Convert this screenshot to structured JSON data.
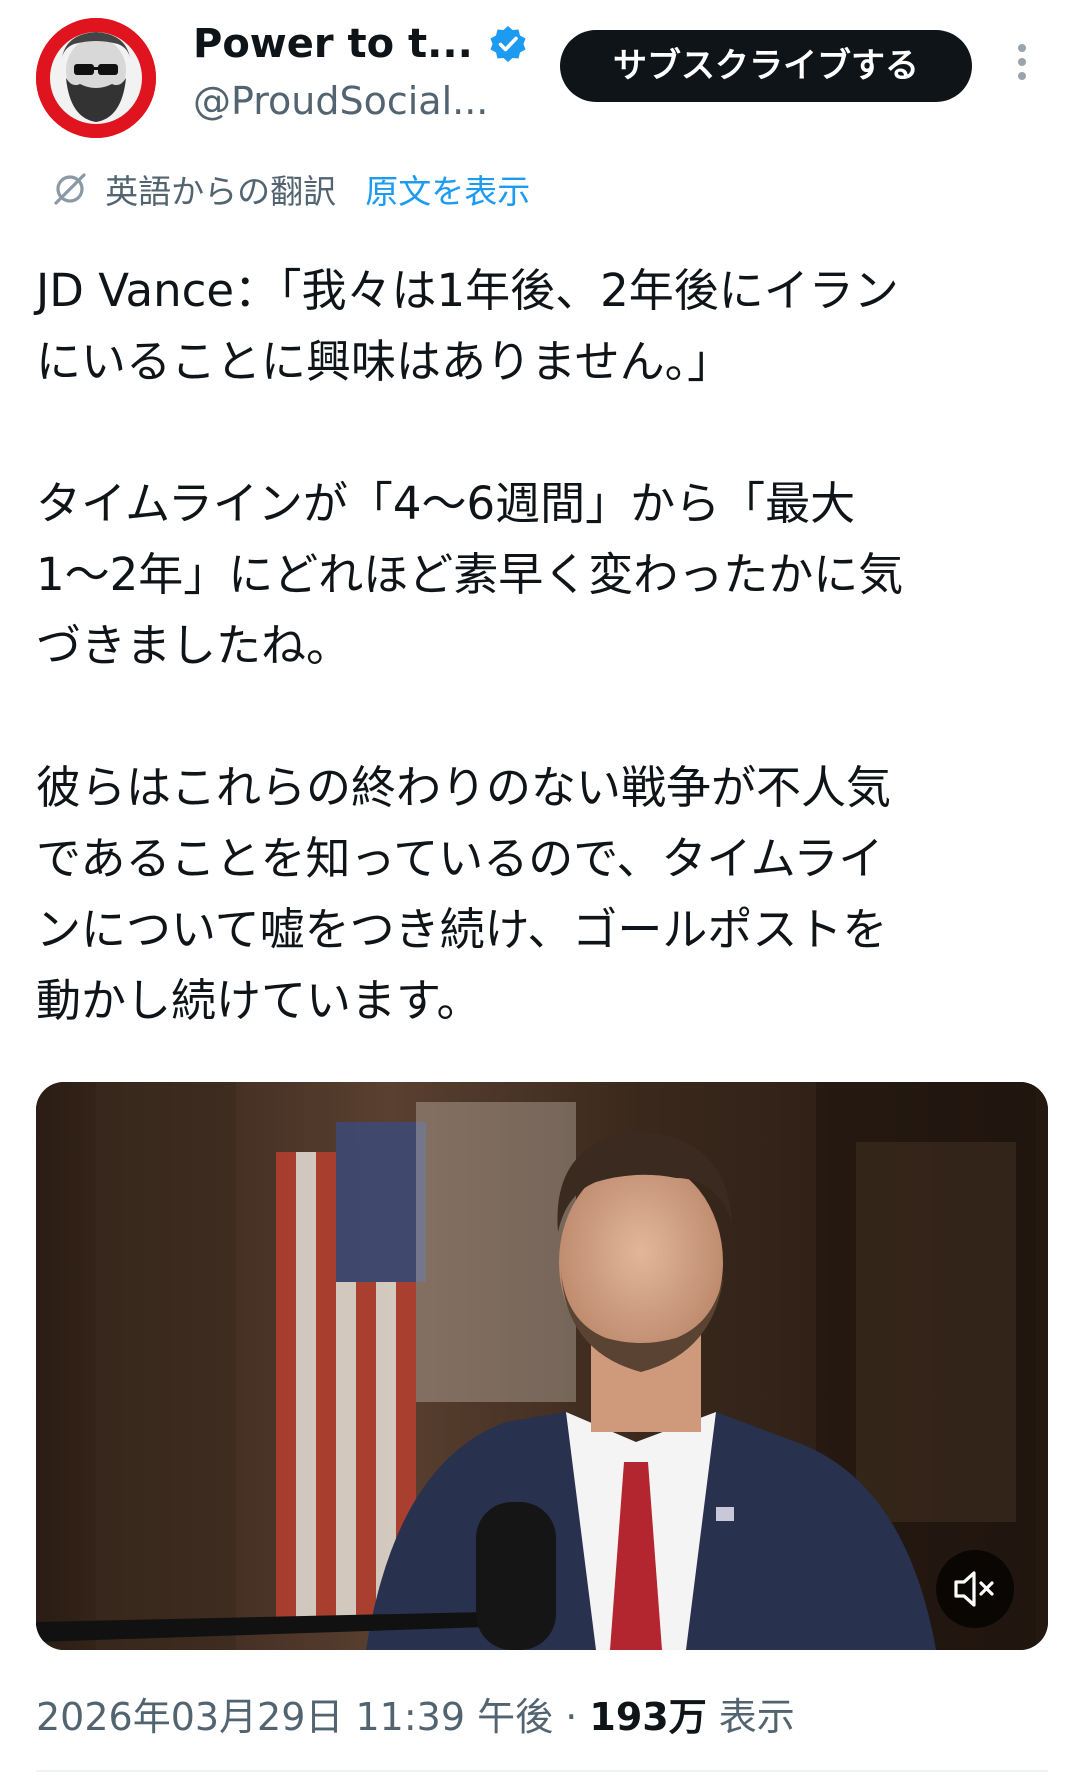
{
  "header": {
    "display_name": "Power to t...",
    "handle": "@ProudSocial...",
    "subscribe_label": "サブスクライブする"
  },
  "translation": {
    "label": "英語からの翻訳",
    "show_original": "原文を表示"
  },
  "tweet": {
    "text": "JD Vance：「我々は1年後、2年後にイラン\nにいることに興味はありません。」\n\nタイムラインが「4〜6週間」から「最大\n1〜2年」にどれほど素早く変わったかに気\nづきましたね。\n\n彼らはこれらの終わりのない戦争が不人気\nであることを知っているので、タイムライ\nンについて嘘をつき続け、ゴールポストを\n動かし続けています。"
  },
  "meta": {
    "timestamp": "2026年03月29日 11:39 午後",
    "separator": "·",
    "views_count": "193万",
    "views_label": "表示"
  },
  "icons": {
    "avatar": "avatar-karl-marx-sunglasses",
    "verified": "verified-badge-icon",
    "translate": "translate-icon",
    "more": "more-options-icon",
    "mute": "muted-speaker-icon"
  },
  "colors": {
    "accent": "#1d9bf0",
    "avatar_bg": "#e0141e",
    "secondary_text": "#536471",
    "primary_text": "#0f1419"
  }
}
